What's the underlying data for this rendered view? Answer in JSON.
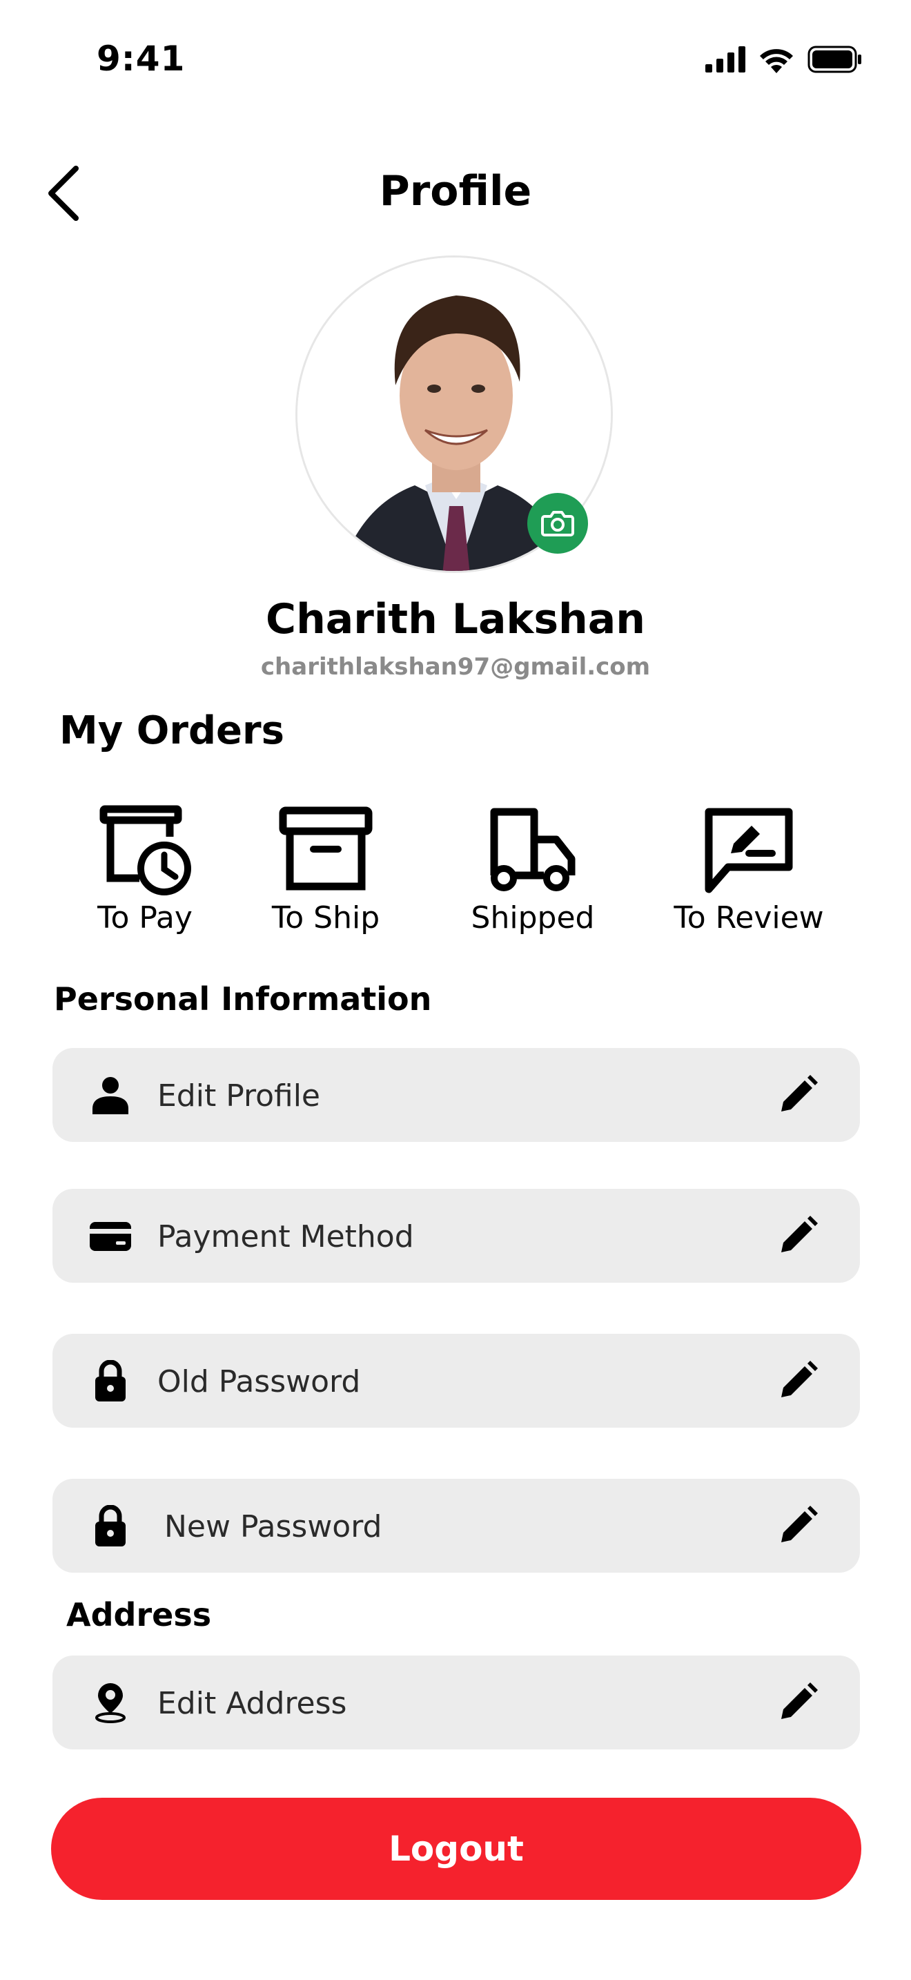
{
  "status_bar": {
    "time": "9:41"
  },
  "header": {
    "title": "Profile"
  },
  "profile": {
    "name": "Charith Lakshan",
    "email": "charithlakshan97@gmail.com"
  },
  "orders": {
    "title": "My Orders",
    "items": [
      {
        "label": "To Pay",
        "icon": "payment-pending-icon"
      },
      {
        "label": "To Ship",
        "icon": "archive-box-icon"
      },
      {
        "label": "Shipped",
        "icon": "truck-icon"
      },
      {
        "label": "To Review",
        "icon": "review-icon"
      }
    ]
  },
  "personal": {
    "title": "Personal Information",
    "fields": [
      {
        "label": "Edit Profile",
        "icon": "person-icon"
      },
      {
        "label": "Payment Method",
        "icon": "card-icon"
      },
      {
        "label": "Old Password",
        "icon": "lock-icon"
      },
      {
        "label": "New Password",
        "icon": "lock-icon"
      }
    ]
  },
  "address": {
    "title": "Address",
    "fields": [
      {
        "label": "Edit Address",
        "icon": "location-pin-icon"
      }
    ]
  },
  "logout": {
    "label": "Logout"
  },
  "colors": {
    "accent_red": "#f5222d",
    "camera_green": "#1f9d55",
    "field_bg": "#ececec",
    "email_gray": "#8a8a8a"
  }
}
